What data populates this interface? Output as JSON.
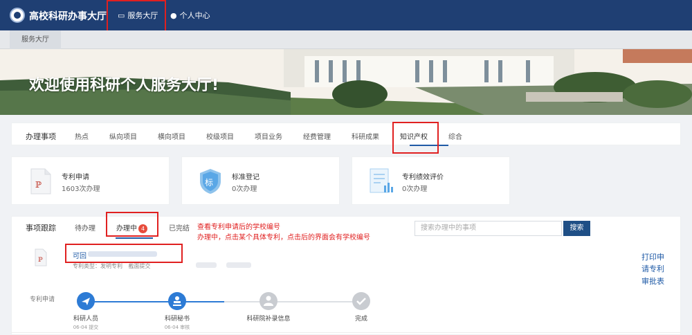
{
  "header": {
    "brand": "高校科研办事大厅",
    "nav": [
      {
        "label": "服务大厅",
        "icon": "monitor-icon"
      },
      {
        "label": "个人中心",
        "icon": "user-icon"
      }
    ]
  },
  "subnav": {
    "tab": "服务大厅"
  },
  "banner": {
    "title": "欢迎使用科研个人服务大厅!"
  },
  "tabs": {
    "heading": "办理事项",
    "items": [
      "热点",
      "纵向项目",
      "横向项目",
      "校级项目",
      "项目业务",
      "经费管理",
      "科研成果",
      "知识产权",
      "综合"
    ],
    "active": "知识产权"
  },
  "services": [
    {
      "name": "专利申请",
      "count": "1603次办理",
      "icon": "patent-doc-icon"
    },
    {
      "name": "标准登记",
      "count": "0次办理",
      "icon": "shield-icon"
    },
    {
      "name": "专利绩效评价",
      "count": "0次办理",
      "icon": "chart-doc-icon"
    }
  ],
  "tracking": {
    "heading": "事项跟踪",
    "tabs": [
      {
        "label": "待办理"
      },
      {
        "label": "办理中",
        "badge": "4"
      },
      {
        "label": "已完结"
      }
    ],
    "note_line1": "查看专利申请后的学校编号",
    "note_line2": "办理中，点击某个具体专利，点击后的界面会有学校编号",
    "search_placeholder": "搜索办理中的事项",
    "search_button": "搜索",
    "item": {
      "title": "可回",
      "meta_type": "专利类型：发明专利",
      "meta_status": "截面提交"
    },
    "actions": [
      "打印申",
      "请专利",
      "审批表"
    ],
    "flow_label": "专利申请",
    "steps": [
      {
        "label": "科研人员",
        "sub": "06-04 提交",
        "state": "done"
      },
      {
        "label": "科研秘书",
        "sub": "06-04 审核",
        "state": "done"
      },
      {
        "label": "科研院补录信息",
        "sub": "",
        "state": "pending"
      },
      {
        "label": "完成",
        "sub": "",
        "state": "pending"
      }
    ]
  },
  "colors": {
    "header": "#1f3f73",
    "accent": "#1f5aa6",
    "highlight": "#e02020",
    "step_done": "#2d7bd5",
    "step_pending": "#c9ccd1"
  }
}
